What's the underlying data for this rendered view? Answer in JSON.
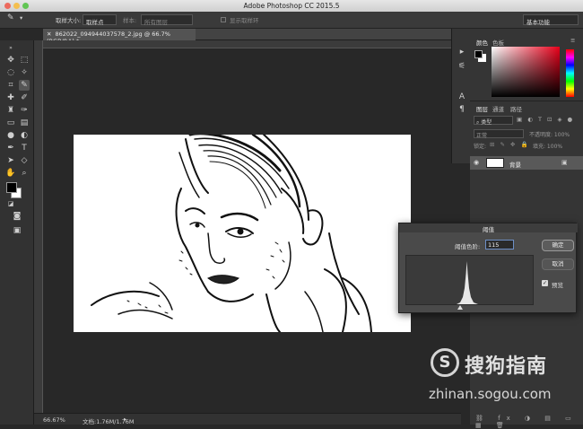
{
  "app": {
    "title": "Adobe Photoshop CC 2015.5",
    "workspace": "基本功能"
  },
  "options_bar": {
    "sample_size_label": "取样大小:",
    "sample_size_value": "取样点",
    "sample_label": "样本:",
    "sample_value": "所有图层",
    "show_ring_label": "显示取样环"
  },
  "document": {
    "tab_label": "862022_094944037578_2.jpg @ 66.7%(RGB/8#) *",
    "zoom": "66.67%",
    "doc_size": "文档:1.76M/1.76M"
  },
  "color_panel": {
    "tab_color": "颜色",
    "tab_swatches": "色板",
    "hue_color": "#e8001a"
  },
  "layers_panel": {
    "tab_layers": "图层",
    "tab_channels": "通道",
    "tab_paths": "路径",
    "filter_label": "类型",
    "blend_mode": "正常",
    "opacity_label": "不透明度: 100%",
    "lock_label": "锁定:",
    "fill_label": "填充: 100%",
    "layer_name": "背景"
  },
  "threshold_dialog": {
    "title": "阈值",
    "level_label": "阈值色阶:",
    "level_value": "115",
    "ok_label": "确定",
    "cancel_label": "取消",
    "preview_label": "预览",
    "preview_checked": true
  },
  "watermark": {
    "brand": "搜狗指南",
    "url": "zhinan.sogou.com"
  }
}
